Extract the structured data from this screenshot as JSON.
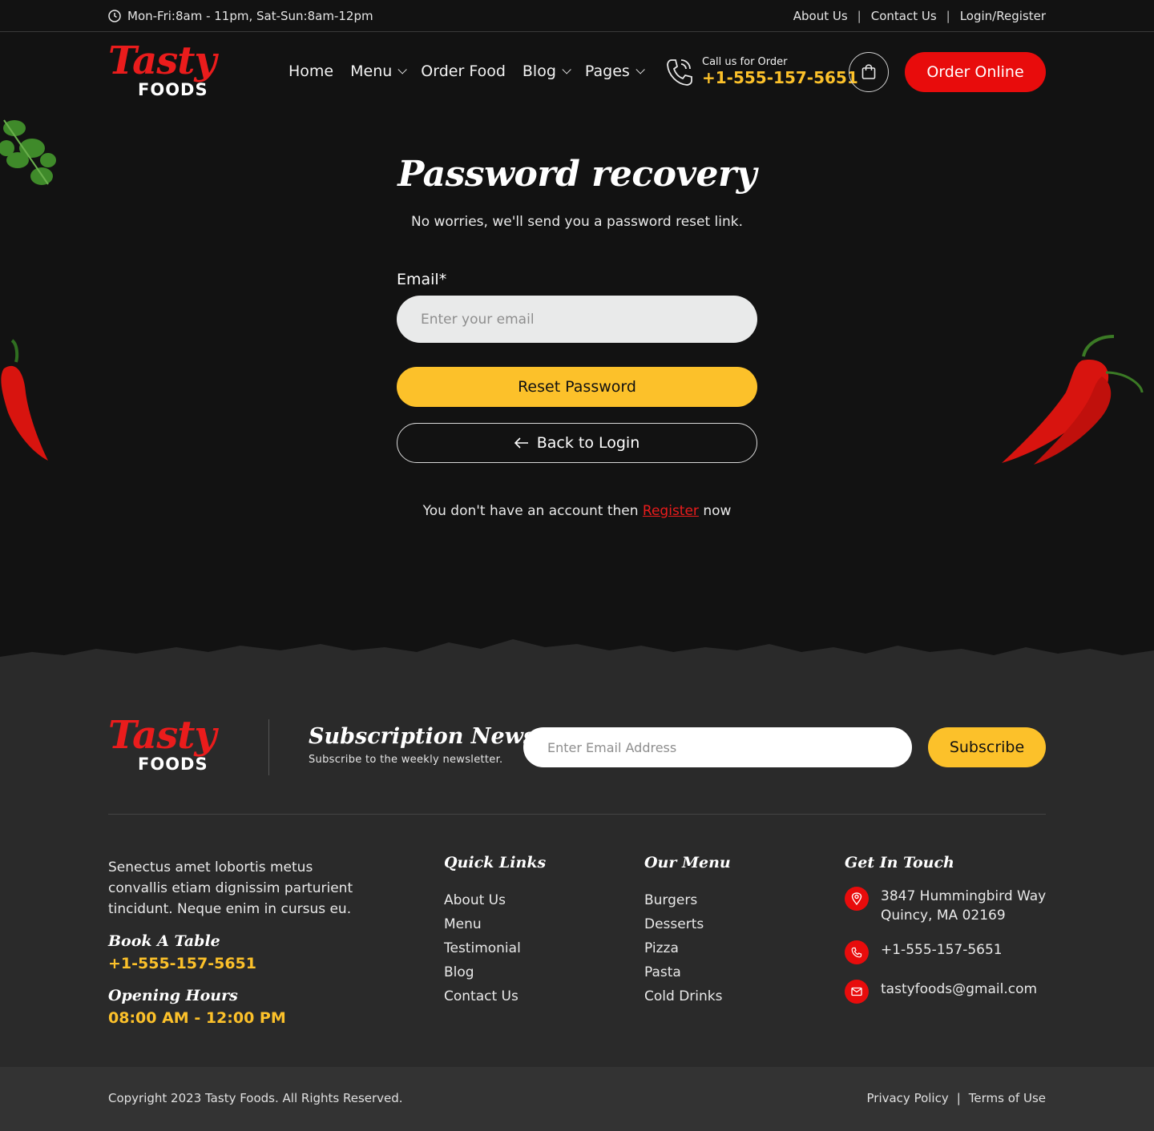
{
  "topbar": {
    "hours": "Mon-Fri:8am - 11pm, Sat-Sun:8am-12pm",
    "links": [
      "About Us",
      "Contact Us",
      "Login/Register"
    ],
    "separator": "|"
  },
  "brand": {
    "name_top": "Tasty",
    "name_bottom": "FOODS",
    "accent": "#ea1c1c"
  },
  "nav": {
    "items": [
      {
        "label": "Home",
        "dropdown": false
      },
      {
        "label": "Menu",
        "dropdown": true
      },
      {
        "label": "Order Food",
        "dropdown": false
      },
      {
        "label": "Blog",
        "dropdown": true
      },
      {
        "label": "Pages",
        "dropdown": true
      }
    ]
  },
  "call": {
    "label": "Call us for Order",
    "phone": "+1-555-157-5651"
  },
  "header": {
    "order_button": "Order Online"
  },
  "form": {
    "title": "Password recovery",
    "subtitle": "No worries, we'll send you a password reset link.",
    "email_label": "Email*",
    "email_placeholder": "Enter your email",
    "email_value": "",
    "reset_button": "Reset Password",
    "back_button": "Back to Login",
    "register_prefix": "You don't have an account then",
    "register_link": "Register",
    "register_suffix": "now"
  },
  "footer": {
    "subscription": {
      "title": "Subscription News",
      "subtitle": "Subscribe to the weekly newsletter.",
      "placeholder": "Enter Email Address",
      "button": "Subscribe"
    },
    "about": "Senectus amet lobortis metus convallis etiam dignissim parturient tincidunt. Neque enim in cursus eu.",
    "book_title": "Book A Table",
    "book_phone": "+1-555-157-5651",
    "hours_title": "Opening Hours",
    "hours_value": "08:00 AM - 12:00 PM",
    "quick_links": {
      "title": "Quick Links",
      "items": [
        "About Us",
        "Menu",
        "Testimonial",
        "Blog",
        "Contact Us"
      ]
    },
    "our_menu": {
      "title": "Our Menu",
      "items": [
        "Burgers",
        "Desserts",
        "Pizza",
        "Pasta",
        "Cold Drinks"
      ]
    },
    "contact": {
      "title": "Get In Touch",
      "address_line1": "3847 Hummingbird Way",
      "address_line2": "Quincy, MA 02169",
      "phone": "+1-555-157-5651",
      "email": "tastyfoods@gmail.com"
    },
    "copyright": "Copyright 2023 Tasty Foods. All Rights Reserved.",
    "legal": [
      "Privacy Policy",
      "Terms of Use"
    ]
  },
  "colors": {
    "primary_red": "#e80c0c",
    "yellow": "#fcc12a",
    "background": "#121212",
    "footer": "#2a2a2a"
  }
}
